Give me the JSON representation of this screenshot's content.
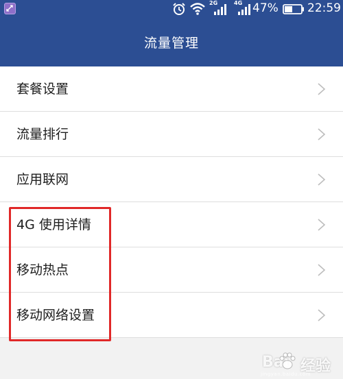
{
  "status_bar": {
    "network_1": "2G",
    "network_2": "4G",
    "battery_percent": "47%",
    "battery_level": 0.47,
    "time": "22:59",
    "icons": [
      "app-notification-icon",
      "alarm-icon",
      "wifi-icon",
      "signal-icon",
      "signal-icon",
      "battery-icon"
    ]
  },
  "header": {
    "title": "流量管理"
  },
  "menu": {
    "items": [
      {
        "label": "套餐设置"
      },
      {
        "label": "流量排行"
      },
      {
        "label": "应用联网"
      },
      {
        "label": "4G 使用详情"
      },
      {
        "label": "移动热点"
      },
      {
        "label": "移动网络设置"
      }
    ]
  },
  "annotation": {
    "highlight_color": "#e02828"
  },
  "watermark": {
    "left": "Bai",
    "right": "经验",
    "sub": "jingyan.baidu.com"
  },
  "colors": {
    "header_bg": "#2c4e93",
    "page_bg": "#f2f2f2",
    "divider": "#dedede"
  }
}
